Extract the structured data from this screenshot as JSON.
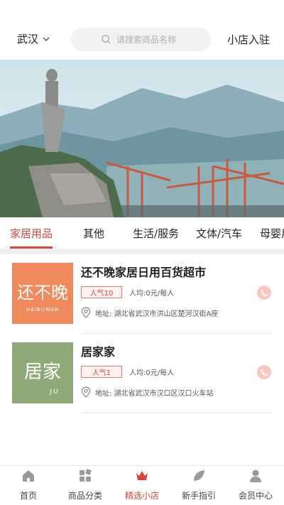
{
  "header": {
    "city": "武汉",
    "search_placeholder": "请搜索商品名称",
    "join_label": "小店入驻"
  },
  "tabs": [
    {
      "label": "家居用品",
      "active": true
    },
    {
      "label": "其他",
      "active": false
    },
    {
      "label": "生活/服务",
      "active": false
    },
    {
      "label": "文体/汽车",
      "active": false
    },
    {
      "label": "母婴用品",
      "active": false
    }
  ],
  "shops": [
    {
      "name": "还不晚家居日用百货超市",
      "logo_text": "还不晚",
      "logo_sub": "HAIBUWAN",
      "logo_color": "#f08a5d",
      "popularity": "人气10",
      "average": "人均:0元/每人",
      "address": "地址: 湖北省武汉市洪山区楚河汉街A座"
    },
    {
      "name": "居家家",
      "logo_text": "居家",
      "logo_sub": "JU",
      "logo_color": "#8faa78",
      "popularity": "人气1",
      "average": "人均:0元/每人",
      "address": "地址: 湖北省武汉市汉口区汉口火车站"
    }
  ],
  "bottom_nav": [
    {
      "label": "首页",
      "icon": "home-icon",
      "active": false
    },
    {
      "label": "商品分类",
      "icon": "category-icon",
      "active": false
    },
    {
      "label": "精选小店",
      "icon": "crown-icon",
      "active": true
    },
    {
      "label": "新手指引",
      "icon": "leaf-icon",
      "active": false
    },
    {
      "label": "会员中心",
      "icon": "user-icon",
      "active": false
    }
  ],
  "colors": {
    "accent": "#d9453b",
    "badge_bg": "#fff1f0",
    "phone_bg": "#f8c9c4"
  }
}
